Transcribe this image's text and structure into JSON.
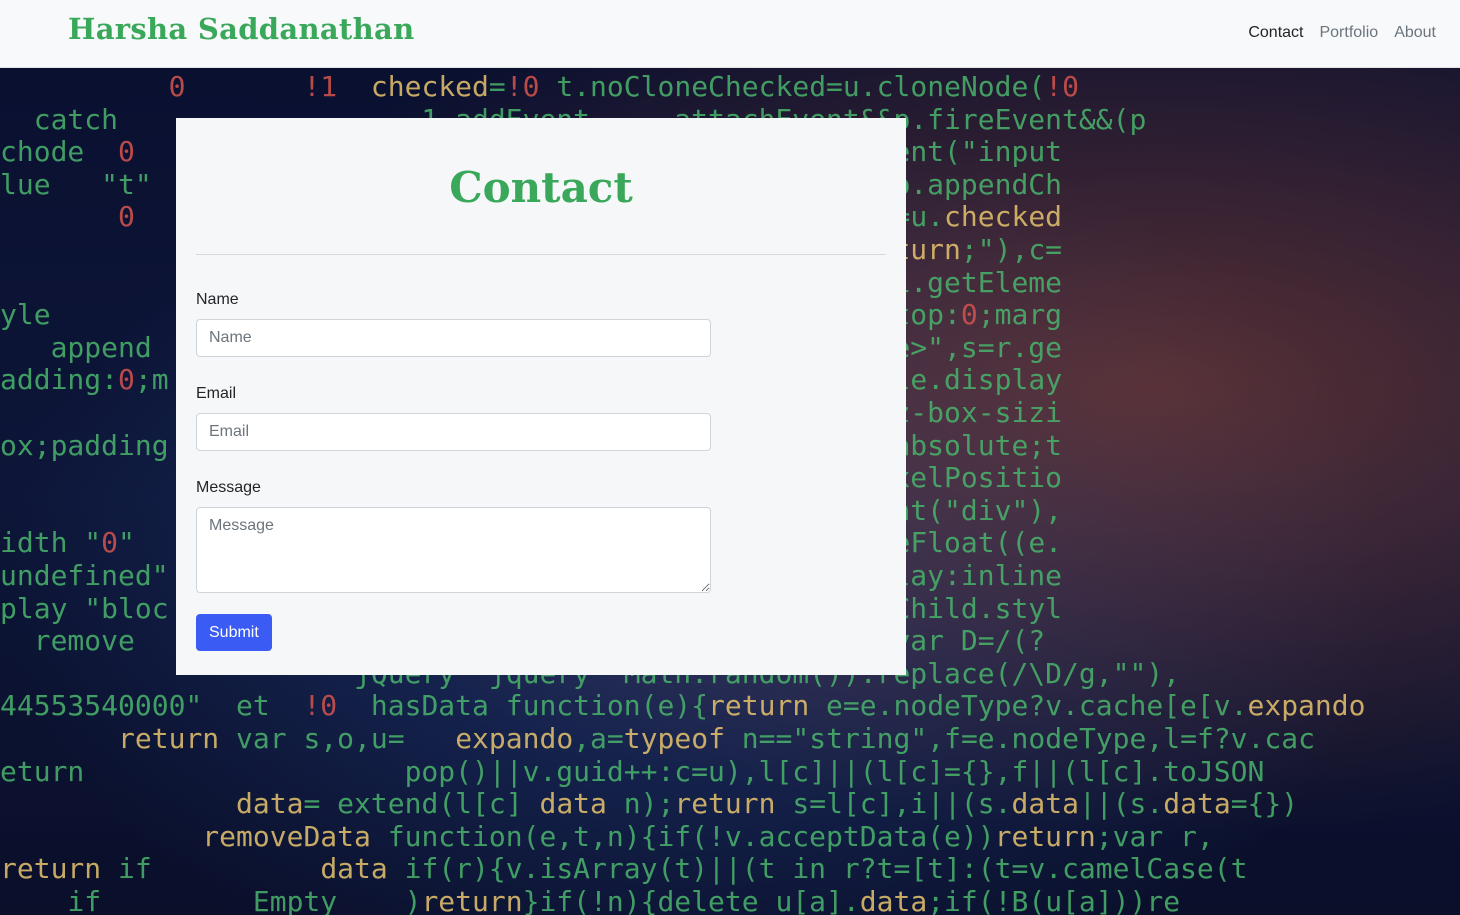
{
  "navbar": {
    "brand": "Harsha Saddanathan",
    "links": [
      {
        "label": "Contact",
        "active": true
      },
      {
        "label": "Portfolio",
        "active": false
      },
      {
        "label": "About",
        "active": false
      }
    ]
  },
  "contact_card": {
    "title": "Contact",
    "fields": {
      "name": {
        "label": "Name",
        "placeholder": "Name",
        "value": ""
      },
      "email": {
        "label": "Email",
        "placeholder": "Email",
        "value": ""
      },
      "message": {
        "label": "Message",
        "placeholder": "Message",
        "value": ""
      }
    },
    "submit_label": "Submit"
  },
  "colors": {
    "brand_green": "#3aa85a",
    "submit_blue": "#3b5bf5",
    "navbar_bg": "#f8f9fa",
    "card_bg": "#f6f7f9"
  },
  "background": {
    "description_icon": "code-matrix-background",
    "code_lines": [
      "          0       !1  checked=!0 t.noCloneChecked=u.cloneNode(!0",
      "  catch                  1 addEvent...  attachEvent&&p.fireEvent&&(p",
      "chode  0                       ck\",h)),u=i.createElement(\"input",
      "lue   \"t\"                      Attribute(\"name\",\"t\"),p.appendCh",
      "       0                       hecked,t.appendChecked=u.checked",
      "                               l(p.setAttribute(f,\"return;\"),c=",
      "                               k;overflow:hidden;\",a=i.getEleme",
      "yle                            ght:0;position:static;top:0;marg",
      "   append                      ><td>t</td></tr></table>\",s=r.ge",
      "adding:0;m                     setHeight===0,s[0].style.display",
      "                               -sizing:border-box;-moz-box-sizi",
      "ox;padding                     argin-top:1%;position:absolute;t",
      "                               etComputedStyle&&(t.pixelPositio",
      "                               =\"4px\",o=i.createElement(\"div\"),",
      "idth \"0\"                       iableMarginRight=!parseFloat((e.",
      "undefined\"                     h:1px;padding:1px;display:inline",
      "play \"bloc                     =\"<div></div>\",r.firstChild.styl",
      "  remove                       r=s=o=u=a=p=null,t}();var D=/(?",
      "                     jQuery  jquery  Math.random()).replace(/\\D/g,\"\"),",
      "44553540000\"  et  !0  hasData function(e){return e=e.nodeType?v.cache[e[v.expando",
      "       return var s,o,u=   expando,a=typeof n==\"string\",f=e.nodeType,l=f?v.cac",
      "eturn                   pop()||v.guid++:c=u),l[c]||(l[c]={},f||(l[c].toJSON",
      "              data= extend(l[c] data n);return s=l[c],i||(s.data||(s.data={})",
      "            removeData function(e,t,n){if(!v.acceptData(e))return;var r,",
      "return if          data if(r){v.isArray(t)||(t in r?t=[t]:(t=v.camelCase(t",
      "    if         Empty    )return}if(!n){delete u[a].data;if(!B(u[a]))re"
    ]
  }
}
